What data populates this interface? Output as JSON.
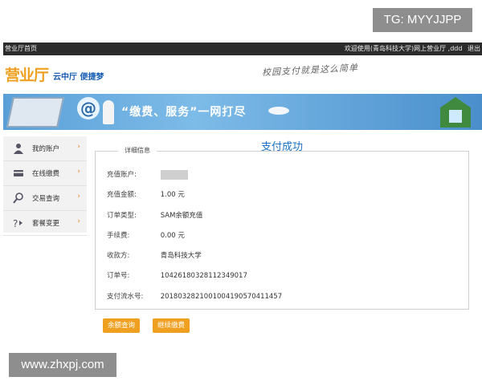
{
  "watermarks": {
    "top": "TG: MYYJJPP",
    "bottom": "www.zhxpj.com"
  },
  "topbar": {
    "home": "营业厅首页",
    "welcome": "欢迎使用(青岛科技大学)网上营业厅 ,ddd",
    "logout": "退出"
  },
  "header": {
    "logo": "营业厅",
    "logo_sub": "云中厅 便捷梦",
    "slogan": "校园支付就是这么简单"
  },
  "banner": {
    "text": "“缴费、服务”一网打尽",
    "at_symbol": "@"
  },
  "sidebar": {
    "items": [
      {
        "label": "我的账户",
        "icon": "user-icon"
      },
      {
        "label": "在线缴费",
        "icon": "payment-icon"
      },
      {
        "label": "交易查询",
        "icon": "search-icon"
      },
      {
        "label": "套餐变更",
        "icon": "change-icon"
      }
    ],
    "arrow": "›"
  },
  "main": {
    "title": "支付成功",
    "legend": "详细信息",
    "fields": [
      {
        "label": "充值账户:",
        "value": ""
      },
      {
        "label": "充值金额:",
        "value": "1.00 元"
      },
      {
        "label": "订单类型:",
        "value": "SAM余额充值"
      },
      {
        "label": "手续费:",
        "value": "0.00 元"
      },
      {
        "label": "收款方:",
        "value": "青岛科技大学"
      },
      {
        "label": "订单号:",
        "value": "10426180328112349017"
      },
      {
        "label": "支付流水号:",
        "value": "2018032821001004190570411457"
      }
    ],
    "buttons": {
      "balance": "余额查询",
      "continue": "继续缴费"
    }
  }
}
